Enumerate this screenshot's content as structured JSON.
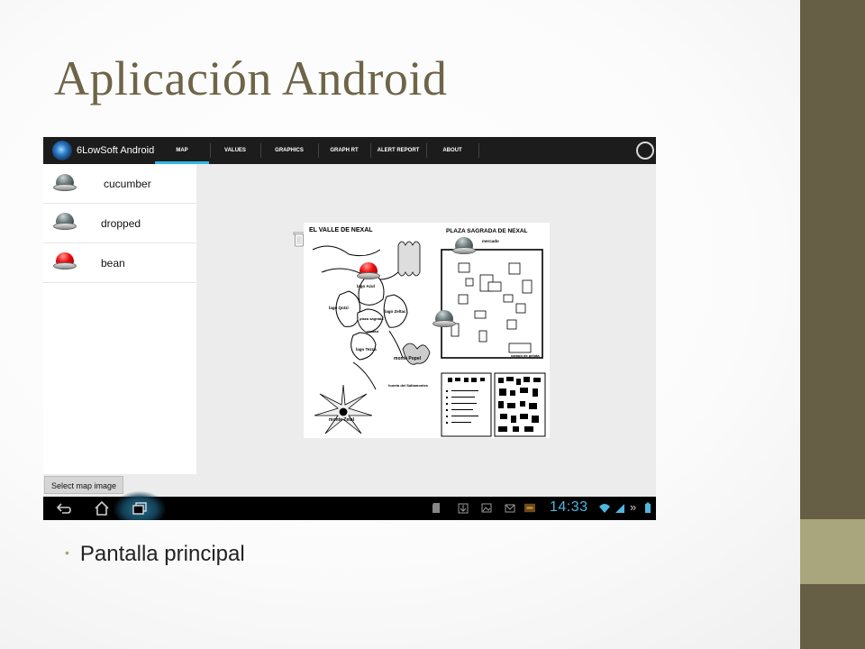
{
  "slide": {
    "title": "Aplicación Android",
    "bullet": "Pantalla principal"
  },
  "app": {
    "name": "6LowSoft Android",
    "tabs": [
      "MAP",
      "VALUES",
      "GRAPHICS",
      "GRAPH RT",
      "ALERT REPORT",
      "ABOUT"
    ],
    "active_tab": "MAP"
  },
  "sensors": [
    {
      "name": "cucumber",
      "status_color": "gray"
    },
    {
      "name": "dropped",
      "status_color": "gray"
    },
    {
      "name": "bean",
      "status_color": "red"
    }
  ],
  "buttons": {
    "select_map": "Select map image"
  },
  "map": {
    "title_left": "EL VALLE DE NEXAL",
    "title_right": "PLAZA SAGRADA DE NEXAL",
    "labels": {
      "lago_azul": "lago Azul",
      "lago_qotzi": "lago Qotzi",
      "lago_zeltac": "lago Zeltac",
      "lago_tezca": "lago Tezca",
      "plaza_sagrada": "plaza sagrada",
      "ciudad": "ciudad",
      "monte_popel": "monte Popel",
      "monte_zetal": "monte Zetal",
      "mercado": "mercado",
      "campo_pelota": "campo de pelota",
      "huerta": "huerta del Saltamontes"
    }
  },
  "status_bar": {
    "clock": "14:33"
  },
  "colors": {
    "accent_bar": "#675e46",
    "accent_light": "#a9a57c",
    "tab_indicator": "#33b5e5",
    "clock": "#4fb6df",
    "alert_red": "#ee1111"
  }
}
